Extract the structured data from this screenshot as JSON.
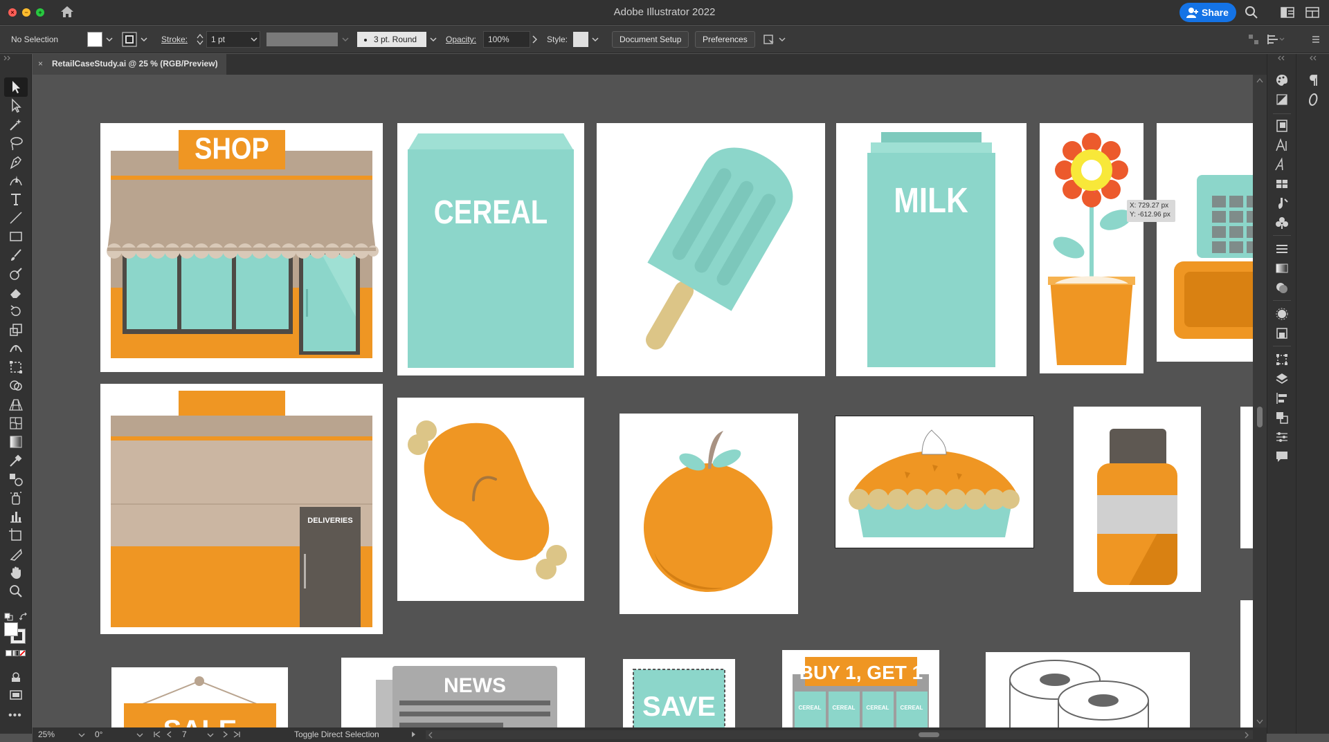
{
  "window": {
    "title": "Adobe Illustrator 2022",
    "share_label": "Share"
  },
  "control_bar": {
    "selection_label": "No Selection",
    "stroke_label": "Stroke:",
    "stroke_value": "1 pt",
    "brush_value": "3 pt. Round",
    "opacity_label": "Opacity:",
    "opacity_value": "100%",
    "style_label": "Style:",
    "document_setup_label": "Document Setup",
    "preferences_label": "Preferences"
  },
  "document_tab": {
    "label": "RetailCaseStudy.ai @ 25 % (RGB/Preview)",
    "close_glyph": "×"
  },
  "artboards": {
    "shop_sign": "SHOP",
    "cereal_box": "CEREAL",
    "milk_carton": "MILK",
    "deliveries_door": "DELIVERIES",
    "sale_sign": "SALE",
    "news_paper": "NEWS",
    "save_coupon": "SAVE",
    "bogo_sign": "BUY 1, GET 1",
    "bogo_boxes": [
      "CEREAL",
      "CEREAL",
      "CEREAL",
      "CEREAL"
    ]
  },
  "tooltip": {
    "x": "X: 729.27 px",
    "y": "Y: -612.96 px"
  },
  "status_bar": {
    "zoom": "25%",
    "rotation": "0°",
    "artboard_number": "7",
    "status_text": "Toggle Direct Selection"
  },
  "colors": {
    "orange": "#ef9623",
    "aqua": "#8cd6ca",
    "tan": "#b9a48f",
    "dark_brown": "#5e5852",
    "flower_red": "#ec5a2c",
    "flower_yellow": "#f8e839",
    "accent_blue": "#1473e6"
  }
}
